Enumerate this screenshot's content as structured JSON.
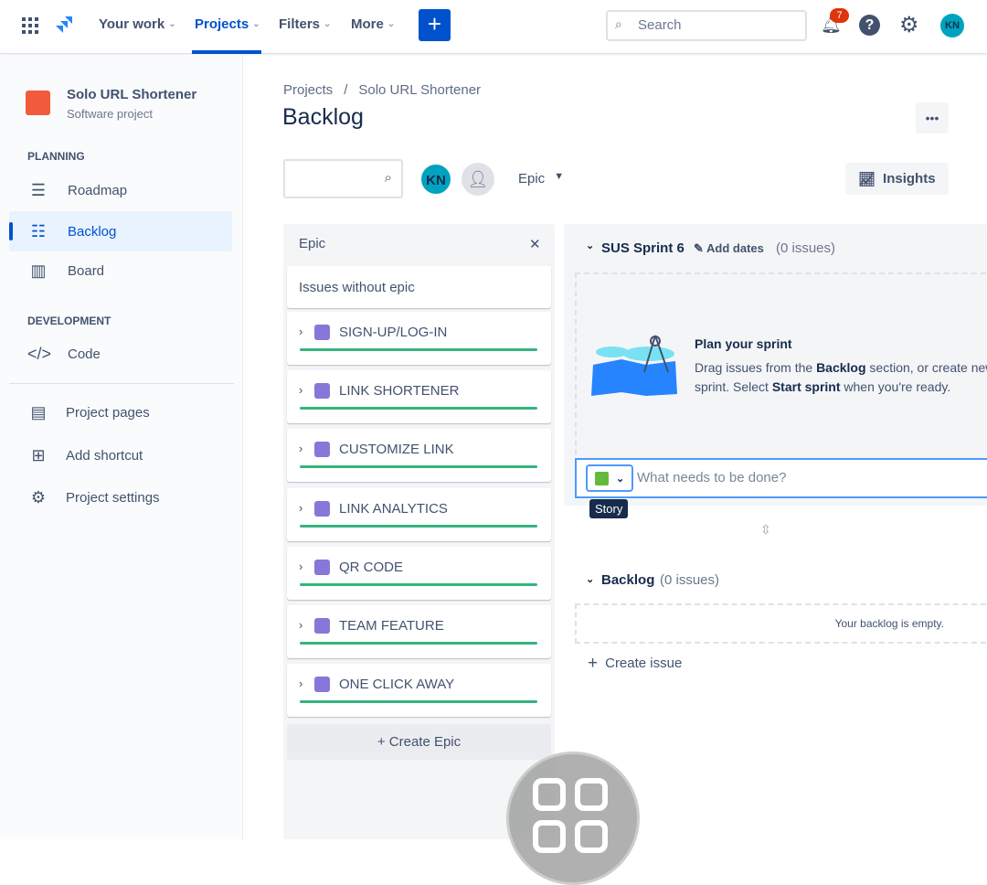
{
  "nav": {
    "items": [
      {
        "label": "Your work"
      },
      {
        "label": "Projects"
      },
      {
        "label": "Filters"
      },
      {
        "label": "More"
      }
    ],
    "create_label": "+",
    "search_placeholder": "Search",
    "notifications_count": "7",
    "user_initials": "KN",
    "accent": "#0052cc"
  },
  "sidebar": {
    "project_name": "Solo URL Shortener",
    "project_type": "Software project",
    "planning_heading": "PLANNING",
    "development_heading": "DEVELOPMENT",
    "items": [
      {
        "label": "Roadmap",
        "icon": "roadmap-icon"
      },
      {
        "label": "Backlog",
        "icon": "backlog-icon",
        "active": true
      },
      {
        "label": "Board",
        "icon": "board-icon"
      },
      {
        "label": "Code",
        "icon": "code-icon"
      },
      {
        "label": "Project pages",
        "icon": "page-icon"
      },
      {
        "label": "Add shortcut",
        "icon": "add-shortcut-icon"
      },
      {
        "label": "Project settings",
        "icon": "gear-icon"
      }
    ]
  },
  "main": {
    "breadcrumb": [
      "Projects",
      "/",
      "Solo URL Shortener"
    ],
    "title": "Backlog",
    "more_label": "•••",
    "filter_avatar": "KN",
    "epic_filter": "Epic",
    "insights_label": "Insights"
  },
  "epics": {
    "heading": "Epic",
    "close": "✕",
    "no_epic": "Issues without epic",
    "items": [
      "SIGN-UP/LOG-IN",
      "LINK SHORTENER",
      "CUSTOMIZE LINK",
      "LINK ANALYTICS",
      "QR CODE",
      "TEAM FEATURE",
      "ONE CLICK AWAY"
    ],
    "create_label": "+ Create Epic"
  },
  "sprint": {
    "name": "SUS Sprint 6",
    "add_dates": "Add dates",
    "count": "(0 issues)",
    "plan_title": "Plan your sprint",
    "plan_text_1": "Drag issues from the ",
    "plan_bold_1": "Backlog",
    "plan_text_2": " section, or create new sprint. Select ",
    "plan_bold_2": "Start sprint",
    "plan_text_3": " when you're ready.",
    "input_placeholder": "What needs to be done?",
    "issue_type_tooltip": "Story"
  },
  "backlog": {
    "name": "Backlog",
    "count": "(0 issues)",
    "empty": "Your backlog is empty.",
    "create_issue": "Create issue"
  }
}
